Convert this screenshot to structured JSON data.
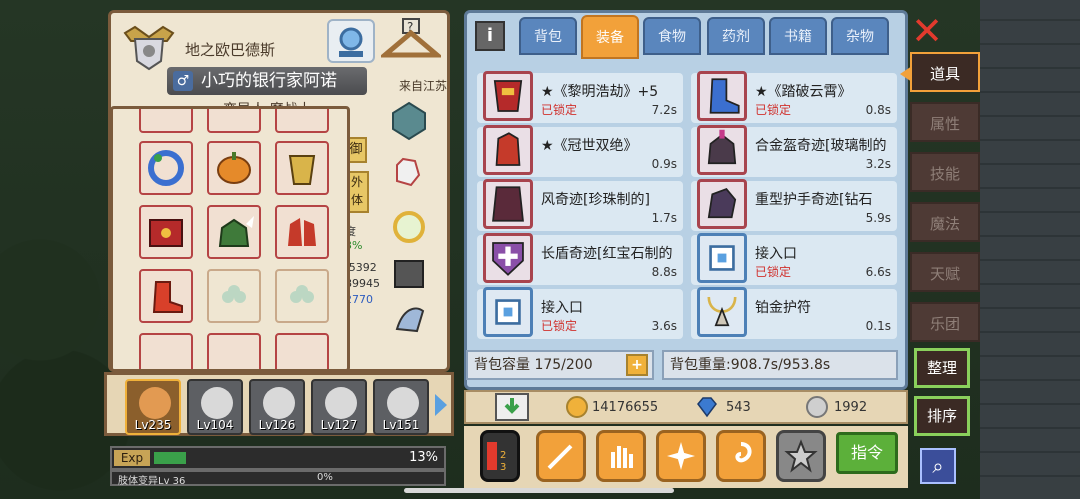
{
  "character": {
    "rank_title": "地之欧巴德斯",
    "name": "小巧的银行家阿诺",
    "gender_symbol": "♂",
    "origin": "来自江苏",
    "subtitle": "变异人·魔战士",
    "side_buttons": [
      "御",
      "外\n体"
    ],
    "stat_fragments": [
      "度",
      "3%",
      "/5392",
      "89945",
      "2770"
    ]
  },
  "heroes": [
    {
      "level": "Lv235",
      "active": true
    },
    {
      "level": "Lv104",
      "active": false
    },
    {
      "level": "Lv126",
      "active": false
    },
    {
      "level": "Lv127",
      "active": false
    },
    {
      "level": "Lv151",
      "active": false
    }
  ],
  "exp": {
    "label": "Exp",
    "percent_text": "13%",
    "fraction": 0.13,
    "sub_label": "肢体变异Lv 36",
    "sub_percent_text": "0%"
  },
  "inventory": {
    "info_label": "i",
    "tabs": [
      {
        "label": "背包",
        "active": false
      },
      {
        "label": "装备",
        "active": true
      },
      {
        "label": "食物",
        "active": false
      },
      {
        "label": "药剂",
        "active": false
      },
      {
        "label": "书籍",
        "active": false
      },
      {
        "label": "杂物",
        "active": false
      }
    ],
    "items": [
      {
        "name": "★《黎明浩劫》+5",
        "locked": "已锁定",
        "weight": "7.2s",
        "icon": "red-armor-icon",
        "frame": "red"
      },
      {
        "name": "★《踏破云霄》",
        "locked": "已锁定",
        "weight": "0.8s",
        "icon": "blue-boots-icon",
        "frame": "red"
      },
      {
        "name": "★《冠世双绝》",
        "locked": "",
        "weight": "0.9s",
        "icon": "red-gauntlet-icon",
        "frame": "red"
      },
      {
        "name": "合金盔奇迹[玻璃制的",
        "locked": "",
        "weight": "3.2s",
        "icon": "helmet-icon",
        "frame": "red"
      },
      {
        "name": "风奇迹[珍珠制的]",
        "locked": "",
        "weight": "1.7s",
        "icon": "cloak-icon",
        "frame": "red"
      },
      {
        "name": "重型护手奇迹[钻石",
        "locked": "",
        "weight": "5.9s",
        "icon": "heavy-gauntlet-icon",
        "frame": "red"
      },
      {
        "name": "长盾奇迹[红宝石制的",
        "locked": "",
        "weight": "8.8s",
        "icon": "shield-icon",
        "frame": "red"
      },
      {
        "name": "接入口",
        "locked": "已锁定",
        "weight": "6.6s",
        "icon": "chip-icon",
        "frame": "blue"
      },
      {
        "name": "接入口",
        "locked": "已锁定",
        "weight": "3.6s",
        "icon": "chip-icon",
        "frame": "blue"
      },
      {
        "name": "铂金护符",
        "locked": "",
        "weight": "0.1s",
        "icon": "amulet-icon",
        "frame": "blue"
      }
    ],
    "capacity_label": "背包容量 175/200",
    "capacity_add": "+",
    "weight_label": "背包重量:908.7s/953.8s"
  },
  "currency": {
    "gold": "14176655",
    "diamond": "543",
    "silver": "1992"
  },
  "actions": {
    "command_label": "指令"
  },
  "side_menu": {
    "tabs": [
      {
        "label": "道具",
        "active": true
      },
      {
        "label": "属性",
        "active": false
      },
      {
        "label": "技能",
        "active": false
      },
      {
        "label": "魔法",
        "active": false
      },
      {
        "label": "天赋",
        "active": false
      },
      {
        "label": "乐团",
        "active": false
      }
    ],
    "organize_label": "整理",
    "sort_label": "排序"
  },
  "colors": {
    "accent_orange": "#f2a13a",
    "tab_blue": "#5a86bd",
    "lock_red": "#d0312d",
    "exp_green": "#3aa04a"
  }
}
